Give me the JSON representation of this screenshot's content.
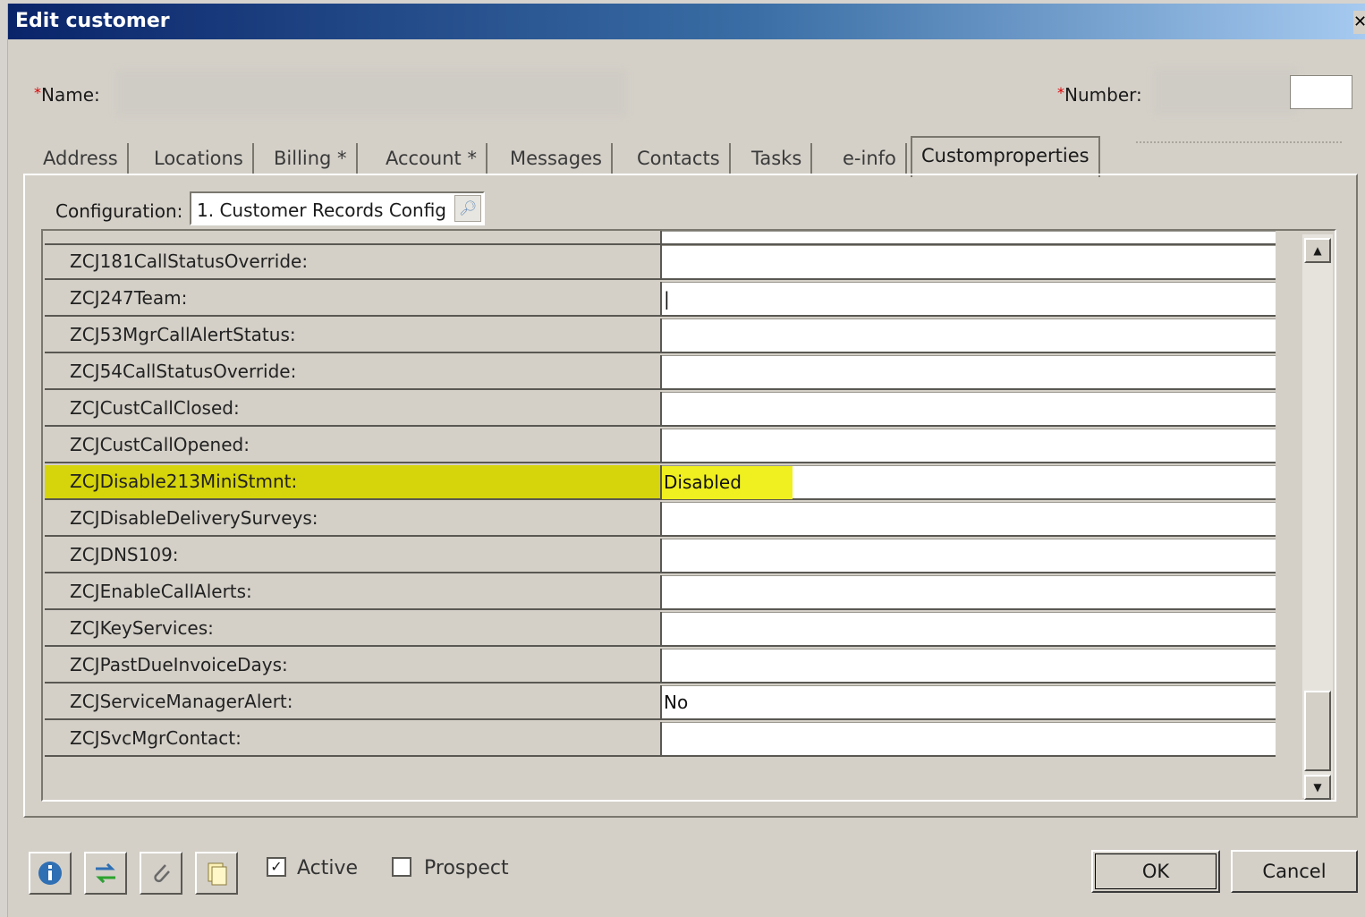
{
  "window": {
    "title": "Edit customer",
    "close_glyph": "✕"
  },
  "header": {
    "name_label": "Name:",
    "number_label": "Number:",
    "required_mark": "*"
  },
  "tabs": [
    {
      "label": "Address"
    },
    {
      "label": "Locations"
    },
    {
      "label": "Billing *"
    },
    {
      "label": "Account *"
    },
    {
      "label": "Messages"
    },
    {
      "label": "Contacts"
    },
    {
      "label": "Tasks"
    },
    {
      "label": "e-info"
    },
    {
      "label": "Customproperties",
      "active": true
    }
  ],
  "config": {
    "label": "Configuration:",
    "value": "1. Customer Records Config",
    "lookup_icon": "magnifier-icon"
  },
  "properties": [
    {
      "name": "ZCJ181CallStatusOverride:",
      "value": ""
    },
    {
      "name": "ZCJ247Team:",
      "value": "|"
    },
    {
      "name": "ZCJ53MgrCallAlertStatus:",
      "value": ""
    },
    {
      "name": "ZCJ54CallStatusOverride:",
      "value": ""
    },
    {
      "name": "ZCJCustCallClosed:",
      "value": ""
    },
    {
      "name": "ZCJCustCallOpened:",
      "value": ""
    },
    {
      "name": "ZCJDisable213MiniStmnt:",
      "value": "Disabled",
      "highlighted": true
    },
    {
      "name": "ZCJDisableDeliverySurveys:",
      "value": ""
    },
    {
      "name": "ZCJDNS109:",
      "value": ""
    },
    {
      "name": "ZCJEnableCallAlerts:",
      "value": ""
    },
    {
      "name": "ZCJKeyServices:",
      "value": ""
    },
    {
      "name": "ZCJPastDueInvoiceDays:",
      "value": ""
    },
    {
      "name": "ZCJServiceManagerAlert:",
      "value": "No"
    },
    {
      "name": "ZCJSvcMgrContact:",
      "value": ""
    }
  ],
  "scrollbar": {
    "up_glyph": "▲",
    "down_glyph": "▼"
  },
  "footer": {
    "icons": [
      "info-icon",
      "sync-icon",
      "attachment-icon",
      "document-icon"
    ],
    "active_label": "Active",
    "active_checked": true,
    "prospect_label": "Prospect",
    "prospect_checked": false,
    "ok_label": "OK",
    "cancel_label": "Cancel"
  }
}
